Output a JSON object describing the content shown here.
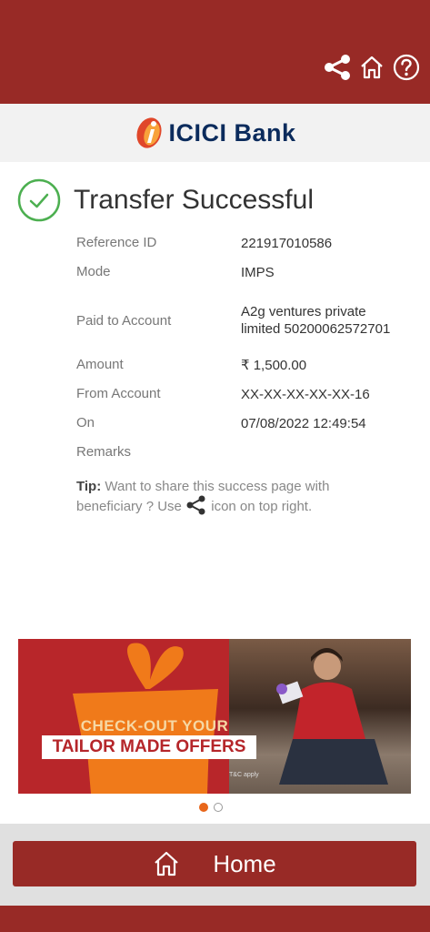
{
  "header": {
    "icons": [
      "share-icon",
      "home-icon",
      "help-icon"
    ],
    "accent_color": "#982a26"
  },
  "brand": {
    "logo_text": "ICICI Bank"
  },
  "status": {
    "icon": "check-circle-icon",
    "title": "Transfer Successful",
    "color": "#4caf50"
  },
  "details": [
    {
      "label": "Reference ID",
      "value": "221917010586"
    },
    {
      "label": "Mode",
      "value": "IMPS"
    },
    {
      "label": "Paid to Account",
      "value": "A2g ventures private limited 50200062572701"
    },
    {
      "label": "Amount",
      "value": "₹ 1,500.00"
    },
    {
      "label": "From Account",
      "value": "XX-XX-XX-XX-XX-16"
    },
    {
      "label": "On",
      "value": "07/08/2022 12:49:54"
    },
    {
      "label": "Remarks",
      "value": ""
    }
  ],
  "tip": {
    "label": "Tip:",
    "text_before": " Want to share this success page with beneficiary ? Use ",
    "text_after": " icon on top right."
  },
  "banner": {
    "line1": "CHECK-OUT YOUR",
    "line2": "TAILOR MADE OFFERS",
    "fine_print": "T&C apply"
  },
  "carousel": {
    "total": 2,
    "active": 1
  },
  "footer": {
    "home_label": "Home",
    "home_icon": "home-icon"
  }
}
